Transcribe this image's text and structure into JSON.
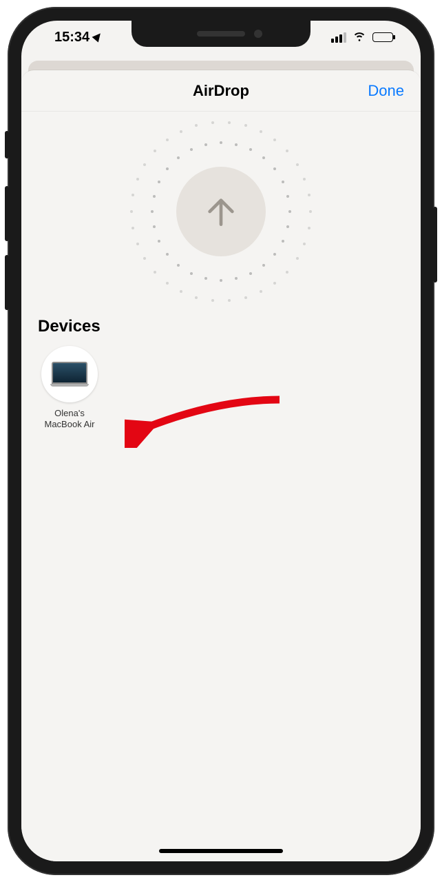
{
  "status": {
    "time": "15:34"
  },
  "sheet": {
    "title": "AirDrop",
    "done_label": "Done"
  },
  "section": {
    "devices_heading": "Devices"
  },
  "devices": [
    {
      "name": "Olena's\nMacBook Air"
    }
  ]
}
